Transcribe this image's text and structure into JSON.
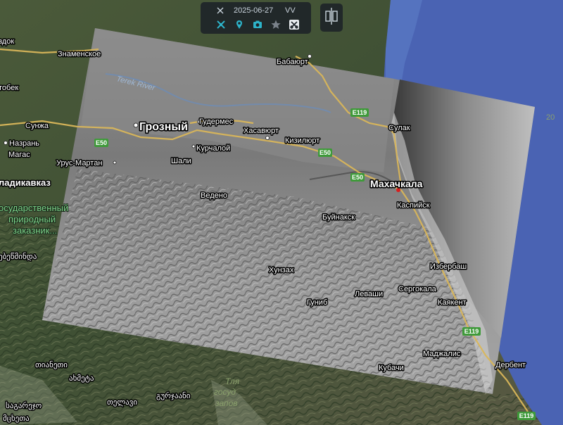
{
  "toolbar": {
    "date": "2025-06-27",
    "polarization": "VV",
    "icons": [
      "crosshair-icon",
      "satellite-icon",
      "location-pin-icon",
      "camera-icon",
      "star-icon",
      "scissors-icon"
    ]
  },
  "split_control": {
    "icon": "split-view-icon"
  },
  "labels": {
    "bavyurt": "Бабаюрт",
    "znamenskoe": "Знаменское",
    "zdok": "здок",
    "tobek": "тобек",
    "terek_river": "Terek River",
    "grozny": "Грозный",
    "gudermes": "Гудермес",
    "khasavyurt": "Хасавюрт",
    "kizilyurt": "Кизилюрт",
    "sulak": "Сулак",
    "sunzha": "Сунжа",
    "nazran": "Назрань",
    "magas": "Магас",
    "kurchaloy": "Курчалой",
    "urus_martan": "Урус-Мартан",
    "shali": "Шали",
    "vladikavkaz": "ладикавказ",
    "makhachkala": "Махачкала",
    "kaspiysk": "Каспийск",
    "vedeno": "Ведено",
    "reserve_1": "осударственный",
    "reserve_2": "природный",
    "reserve_3": "заказник...",
    "buynaksk": "Буйнакск",
    "ge_1": "ებეწმინდა",
    "khunzakh": "Хунзах",
    "izberbash": "Избербаш",
    "levashi": "Леваши",
    "sergokala": "Сергокала",
    "gunib": "Гуниб",
    "kayakent": "Каякент",
    "madzhalis": "Маджалис",
    "derbent": "Дербент",
    "kubachi": "Кубачи",
    "ge_tianeti": "თიანეთი",
    "ge_akhmeta": "ახმეტა",
    "ge_gurjaani": "გურჯაანი",
    "ge_telavi": "თელავი",
    "ge_sagarejo": "საგარეჯო",
    "ge_bottom": "მცხეთა",
    "tlya": "Тля",
    "gosud": "госуд",
    "zapov": "запов",
    "twenty": "20"
  },
  "roads": {
    "e119_a": "E119",
    "e119_b": "E119",
    "e119_c": "E119",
    "e50_a": "E50",
    "e50_b": "E50",
    "e50_c": "E50"
  },
  "colors": {
    "sea": "#4a63b3",
    "terrain": "#3d4f33",
    "shield": "#3f9a3a",
    "road": "#d9b65a",
    "accent": "#2db3c9"
  }
}
